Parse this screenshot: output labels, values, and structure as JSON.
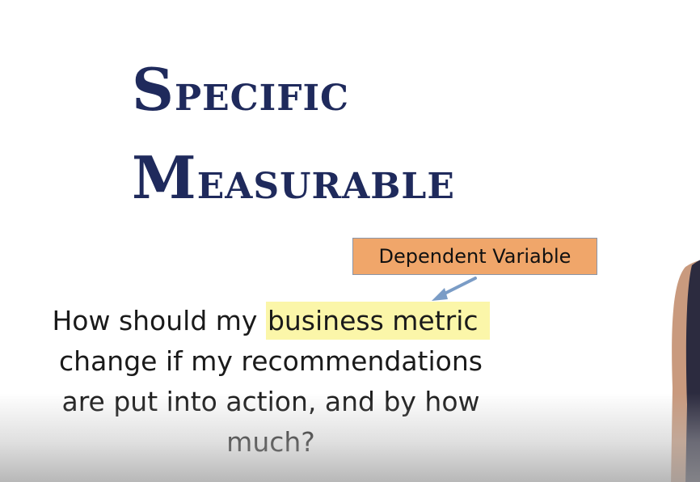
{
  "heading": {
    "specific_initial": "S",
    "specific_rest": "PECIFIC",
    "measurable_initial": "M",
    "measurable_rest": "EASURABLE"
  },
  "callout": {
    "label": "Dependent Variable"
  },
  "question": {
    "line1_prefix": "How should my ",
    "line1_highlight": "business metric",
    "line2": "change if my recommendations",
    "line3": "are put into action, and by how",
    "line4": "much?"
  },
  "colors": {
    "heading": "#1f2a5c",
    "callout_fill": "#f0a66a",
    "highlight": "#fbf6a9",
    "arrow": "#7a9cc6"
  }
}
